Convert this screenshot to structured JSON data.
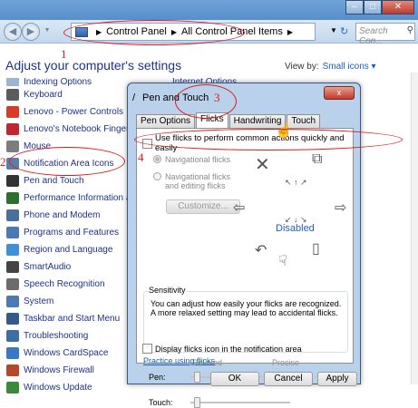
{
  "address": {
    "crumbs": [
      "Control Panel",
      "All Control Panel Items"
    ],
    "search_placeholder": "Search Con..."
  },
  "header": {
    "title": "Adjust your computer's settings",
    "view_by_label": "View by:",
    "view_by_value": "Small icons"
  },
  "items": [
    {
      "label": "Indexing Options",
      "color": "#9bb4d4"
    },
    {
      "label": "Keyboard",
      "color": "#5b5b5b"
    },
    {
      "label": "Lenovo - Power Controls",
      "color": "#d83b2a"
    },
    {
      "label": "Lenovo's Notebook Fingerpri",
      "color": "#c0272d"
    },
    {
      "label": "Mouse",
      "color": "#7d7d7d"
    },
    {
      "label": "Notification Area Icons",
      "color": "#5b7ea8"
    },
    {
      "label": "Pen and Touch",
      "color": "#333333"
    },
    {
      "label": "Performance Information and",
      "color": "#2e6e2e"
    },
    {
      "label": "Phone and Modem",
      "color": "#4a6f9a"
    },
    {
      "label": "Programs and Features",
      "color": "#4c7ab0"
    },
    {
      "label": "Region and Language",
      "color": "#3d8fd6"
    },
    {
      "label": "SmartAudio",
      "color": "#444444"
    },
    {
      "label": "Speech Recognition",
      "color": "#6c6c6c"
    },
    {
      "label": "System",
      "color": "#4d79b5"
    },
    {
      "label": "Taskbar and Start Menu",
      "color": "#34598a"
    },
    {
      "label": "Troubleshooting",
      "color": "#3f6ea6"
    },
    {
      "label": "Windows CardSpace",
      "color": "#3b77c7"
    },
    {
      "label": "Windows Firewall",
      "color": "#b5472b"
    },
    {
      "label": "Windows Update",
      "color": "#3a8a3a"
    }
  ],
  "right_col_item": "Internet Options",
  "annotations": [
    "1",
    "2",
    "3",
    "4"
  ],
  "dialog": {
    "title": "Pen and Touch",
    "close_label": "x",
    "tabs": [
      "Pen Options",
      "Flicks",
      "Handwriting",
      "Touch"
    ],
    "active_tab": "Flicks",
    "use_flicks_label": "Use flicks to perform common actions quickly and easily",
    "radio_navigational": "Navigational flicks",
    "radio_editing": "Navigational flicks and editing flicks",
    "customize_label": "Customize...",
    "disabled_label": "Disabled",
    "sensitivity_title": "Sensitivity",
    "sensitivity_desc": "You can adjust how easily your flicks are recognized. A more relaxed setting may lead to accidental flicks.",
    "relaxed_label": "Relaxed",
    "precise_label": "Precise",
    "pen_label": "Pen:",
    "touch_label": "Touch:",
    "display_icon_label": "Display flicks icon in the notification area",
    "practice_link": "Practice using flicks",
    "ok_label": "OK",
    "cancel_label": "Cancel",
    "apply_label": "Apply"
  }
}
